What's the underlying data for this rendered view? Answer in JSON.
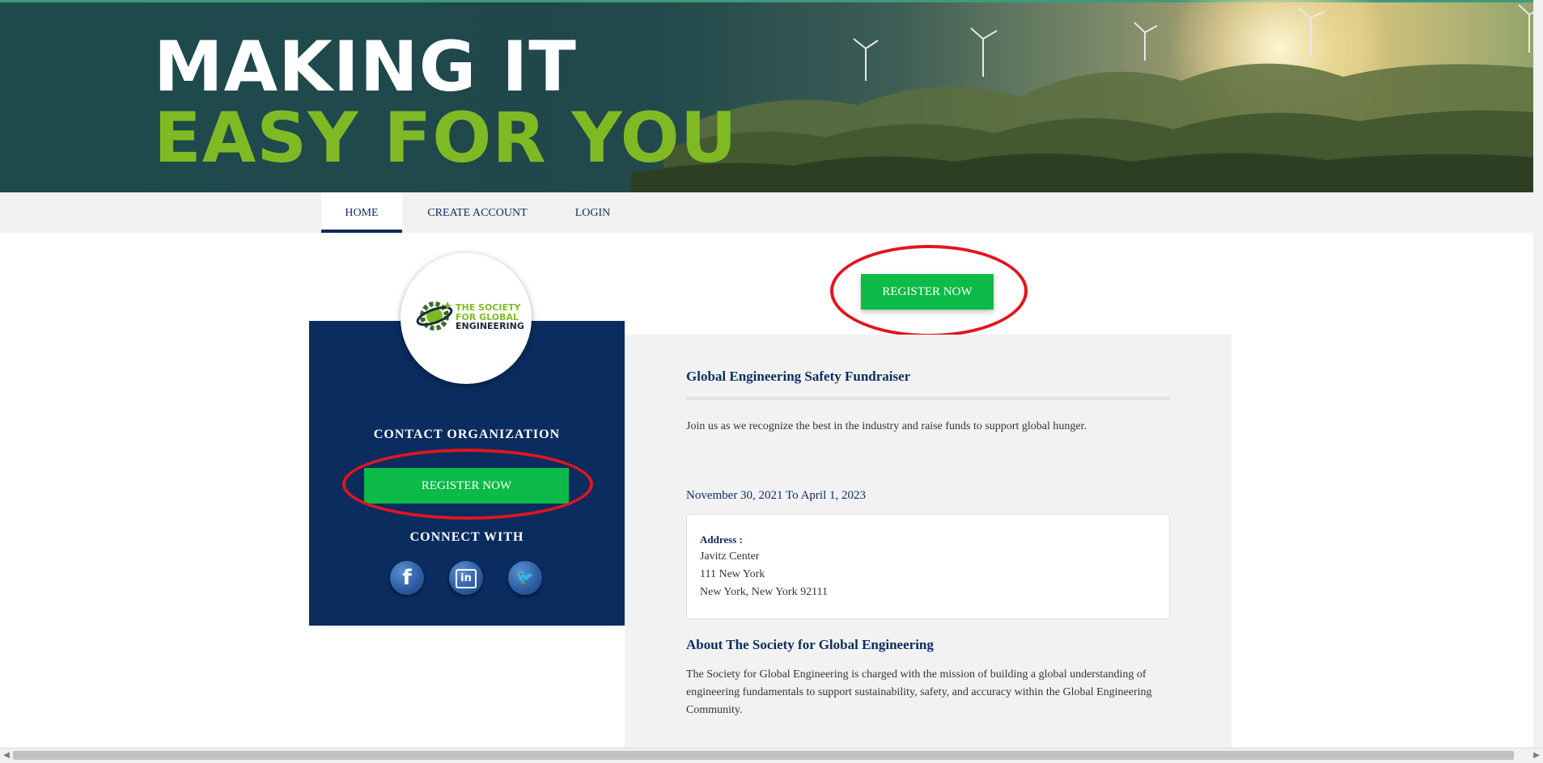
{
  "hero": {
    "line1": "MAKING IT",
    "line2": "EASY FOR YOU",
    "line2_color": "#7fba24"
  },
  "nav": {
    "items": [
      {
        "label": "HOME",
        "active": true
      },
      {
        "label": "CREATE ACCOUNT",
        "active": false
      },
      {
        "label": "LOGIN",
        "active": false
      }
    ],
    "color": "#0b2c5f"
  },
  "org": {
    "logo": {
      "line1": "THE SOCIETY",
      "line2": "FOR GLOBAL",
      "line3": "ENGINEERING"
    },
    "contact_heading": "CONTACT ORGANIZATION",
    "register_label": "REGISTER NOW",
    "connect_heading": "CONNECT WITH",
    "social": [
      {
        "icon": "facebook-icon",
        "glyph": "f"
      },
      {
        "icon": "linkedin-icon",
        "glyph": "in"
      },
      {
        "icon": "twitter-icon",
        "glyph": "🐦"
      }
    ],
    "panel_color": "#0b2c5f"
  },
  "top_register": {
    "label": "REGISTER NOW",
    "color": "#0cba48"
  },
  "event": {
    "title": "Global Engineering Safety Fundraiser",
    "description": "Join us as we recognize the best in the industry and raise funds to support global hunger.",
    "dates": "November 30, 2021 To April 1, 2023",
    "address": {
      "label": "Address :",
      "line1": "Javitz Center",
      "line2": "111 New York",
      "line3": "New York, New York 92111"
    },
    "about_title": "About The Society for Global Engineering",
    "about_text": "The Society for Global Engineering is charged with the mission of building a global understanding of engineering fundamentals to support sustainability, safety, and accuracy within the Global Engineering Community."
  },
  "annotation_color": "#e0161f"
}
